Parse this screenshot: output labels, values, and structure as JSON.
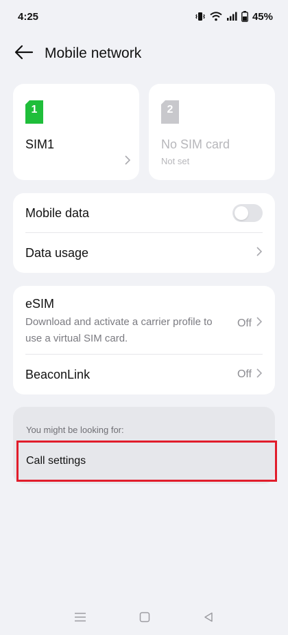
{
  "status_bar": {
    "time": "4:25",
    "battery": "45%",
    "icons": [
      "vibrate-icon",
      "wifi-icon",
      "signal-icon",
      "battery-icon"
    ]
  },
  "header": {
    "back_icon": "arrow-left-icon",
    "title": "Mobile network"
  },
  "sims": [
    {
      "number": "1",
      "name": "SIM1",
      "status": "",
      "color": "#1fbe3a",
      "active": true
    },
    {
      "number": "2",
      "name": "No SIM card",
      "status": "Not set",
      "color": "#c8c8cc",
      "active": false
    }
  ],
  "data_card": {
    "mobile_data_label": "Mobile data",
    "mobile_data_enabled": false,
    "data_usage_label": "Data usage"
  },
  "esim_card": {
    "esim_label": "eSIM",
    "esim_desc": "Download and activate a carrier profile to use a virtual SIM card.",
    "esim_value": "Off",
    "beaconlink_label": "BeaconLink",
    "beaconlink_value": "Off"
  },
  "suggestions": {
    "heading": "You might be looking for:",
    "items": [
      "Call settings"
    ]
  },
  "highlight_color": "#e11d2b",
  "nav_bar": {
    "icons": [
      "menu-icon",
      "home-square-icon",
      "back-triangle-icon"
    ]
  }
}
